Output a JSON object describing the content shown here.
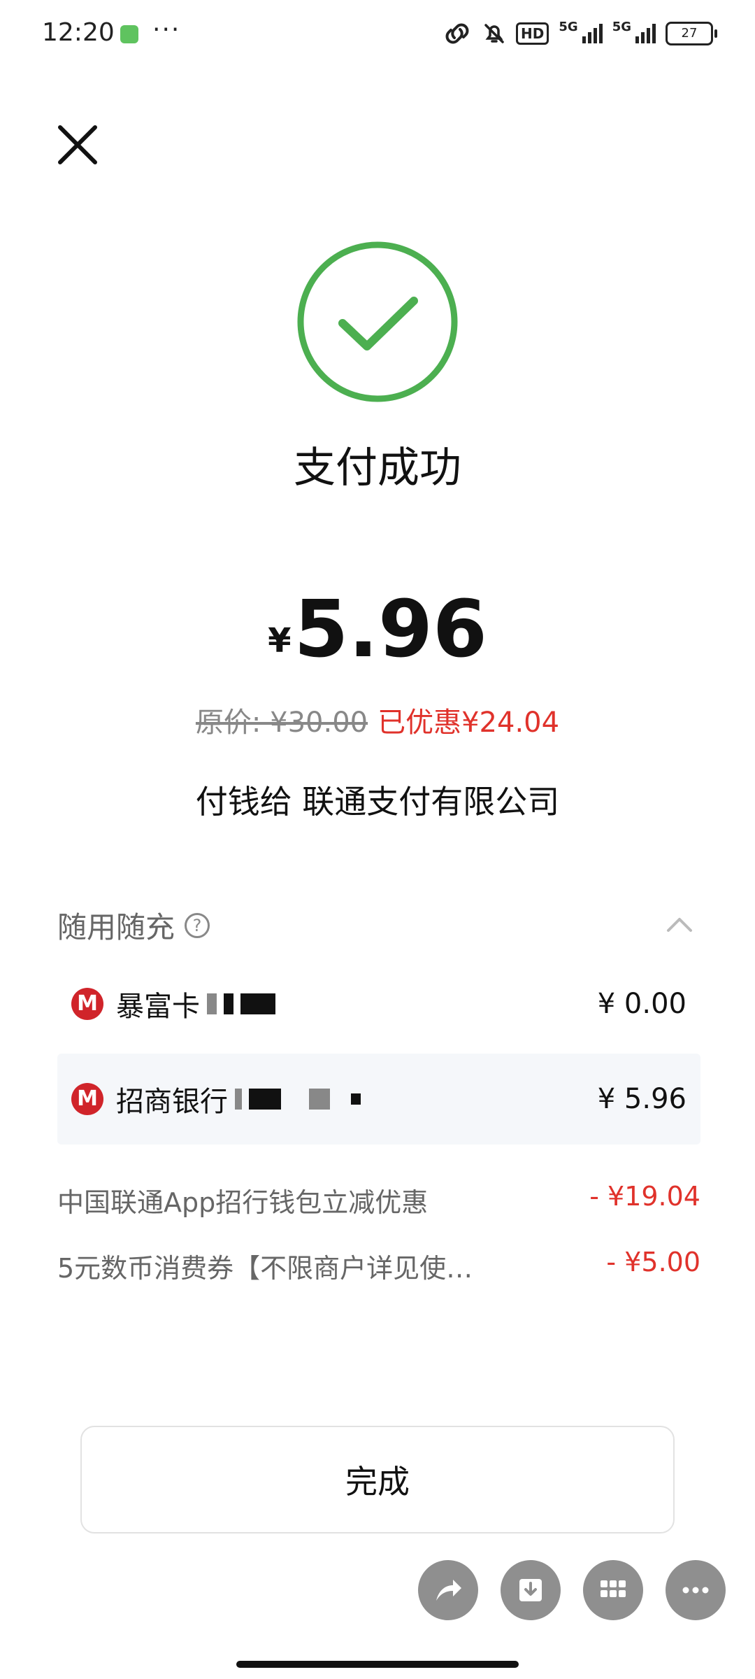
{
  "status_bar": {
    "time": "12:20",
    "more": "···",
    "hd_label": "HD",
    "net1": "5G",
    "net2": "5G",
    "battery": "27"
  },
  "success": {
    "title": "支付成功",
    "color": "#4caf50"
  },
  "payment": {
    "currency": "¥",
    "amount": "5.96",
    "original_price": "原价: ¥30.00",
    "discount": "已优惠¥24.04",
    "payee": "付钱给 联通支付有限公司"
  },
  "methods": {
    "title": "随用随充",
    "items": [
      {
        "name": "暴富卡",
        "amount": "¥ 0.00"
      },
      {
        "name": "招商银行",
        "amount": "¥ 5.96"
      }
    ]
  },
  "promotions": [
    {
      "label": "中国联通App招行钱包立减优惠",
      "value": "- ¥19.04"
    },
    {
      "label": "5元数币消费券【不限商户详见使…",
      "value": "- ¥5.00"
    }
  ],
  "done_label": "完成",
  "colors": {
    "accent_red": "#e0322b",
    "bank_red": "#d0242a"
  }
}
